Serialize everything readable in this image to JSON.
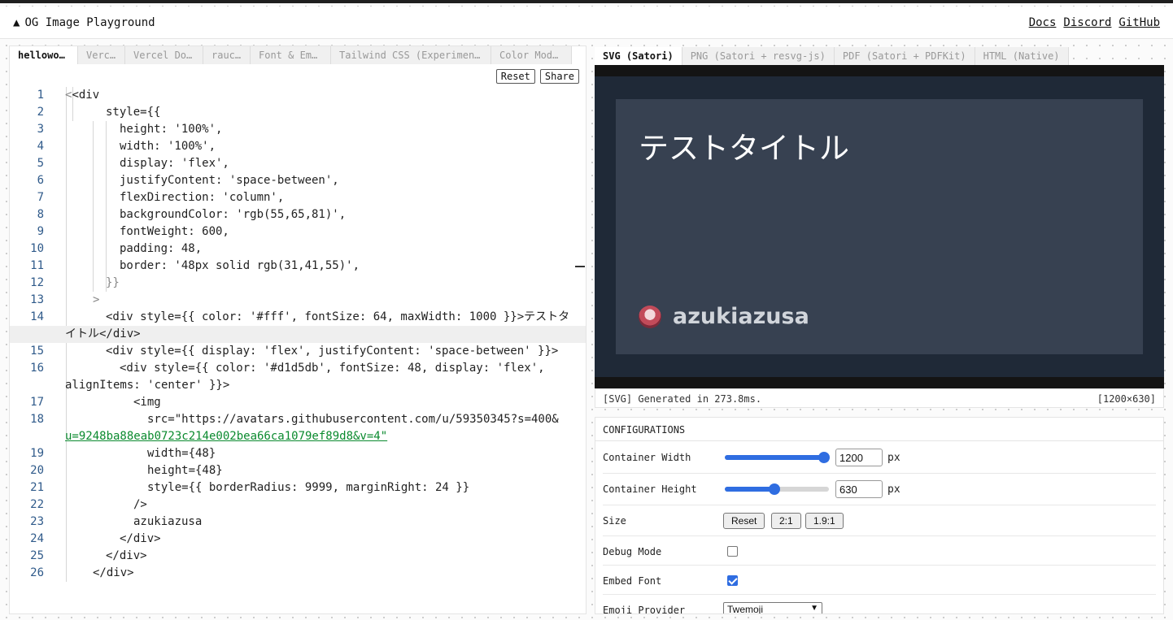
{
  "header": {
    "logo_glyph": "▲",
    "title": "OG Image Playground",
    "links": [
      "Docs",
      "Discord",
      "GitHub"
    ]
  },
  "editor": {
    "tabs": [
      "hellowor…",
      "Verc…",
      "Vercel Do…",
      "rauc…",
      "Font & Emo…",
      "Tailwind CSS (Experiment…",
      "Color Mode…"
    ],
    "active_tab_index": 0,
    "reset_label": "Reset",
    "share_label": "Share",
    "line_numbers": [
      "1",
      "2",
      "3",
      "4",
      "5",
      "6",
      "7",
      "8",
      "9",
      "10",
      "11",
      "12",
      "13",
      "14",
      "15",
      "16",
      "17",
      "18",
      "19",
      "20",
      "21",
      "22",
      "23",
      "24",
      "25",
      "26"
    ],
    "lines": [
      "<div",
      "style={{",
      "height: '100%',",
      "width: '100%',",
      "display: 'flex',",
      "justifyContent: 'space-between',",
      "flexDirection: 'column',",
      "backgroundColor: 'rgb(55,65,81)',",
      "fontWeight: 600,",
      "padding: 48,",
      "border: '48px solid rgb(31,41,55)',",
      "}}",
      ">",
      "<div style={{ color: '#fff', fontSize: 64, maxWidth: 1000 }}>テストタ",
      "<div style={{ display: 'flex', justifyContent: 'space-between' }}>",
      "<div style={{ color: '#d1d5db', fontSize: 48, display: 'flex',",
      "<img",
      "src=\"https://avatars.githubusercontent.com/u/59350345?s=400&",
      "width={48}",
      "height={48}",
      "style={{ borderRadius: 9999, marginRight: 24 }}",
      "/>",
      "azukiazusa",
      "</div>",
      "</div>",
      "</div>"
    ],
    "wrap_14": "イトル</div>",
    "wrap_16": "alignItems: 'center' }}>",
    "wrap_18": "u=9248ba88eab0723c214e002bea66ca1079ef89d8&v=4\""
  },
  "preview": {
    "tabs": [
      "SVG (Satori)",
      "PNG (Satori + resvg-js)",
      "PDF (Satori + PDFKit)",
      "HTML (Native)"
    ],
    "active_tab_index": 0,
    "og_title": "テストタイトル",
    "og_author": "azukiazusa",
    "status_left": "[SVG] Generated in 273.8ms.",
    "status_right": "[1200×630]"
  },
  "config": {
    "title": "CONFIGURATIONS",
    "container_width_label": "Container Width",
    "container_width_value": "1200",
    "container_width_fraction": 0.95,
    "container_height_label": "Container Height",
    "container_height_value": "630",
    "container_height_fraction": 0.48,
    "unit": "px",
    "size_label": "Size",
    "size_buttons": [
      "Reset",
      "2:1",
      "1.9:1"
    ],
    "debug_label": "Debug Mode",
    "debug_checked": false,
    "embed_label": "Embed Font",
    "embed_checked": true,
    "emoji_label": "Emoji Provider",
    "emoji_value": "Twemoji"
  },
  "colors": {
    "accent": "#2f6de1",
    "og_background": "#374151",
    "og_border": "#1f2937",
    "og_author_color": "#d1d5db",
    "string_green": "#0a8a2e",
    "number_blue": "#2f4ab8"
  }
}
